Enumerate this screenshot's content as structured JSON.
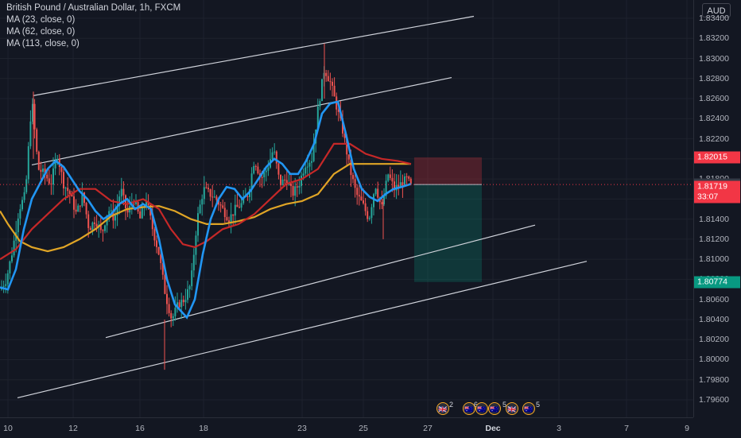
{
  "header": {
    "symbol_line": "British Pound / Australian Dollar, 1h, FXCM",
    "indicators": [
      "MA (23, close, 0)",
      "MA (62, close, 0)",
      "MA (113, close, 0)"
    ]
  },
  "price_axis": {
    "currency": "AUD",
    "ticks": [
      "1.83400",
      "1.83200",
      "1.83000",
      "1.82800",
      "1.82600",
      "1.82400",
      "1.82200",
      "1.82000",
      "1.81800",
      "1.81600",
      "1.81400",
      "1.81200",
      "1.81000",
      "1.80800",
      "1.80600",
      "1.80400",
      "1.80200",
      "1.80000",
      "1.79800",
      "1.79600"
    ],
    "labels": [
      {
        "text": "1.82015",
        "value": 1.82015,
        "color": "#f23645"
      },
      {
        "text": "1.81744",
        "value": 1.81744,
        "color": "#363a45"
      },
      {
        "text": "1.81719",
        "value": 1.81719,
        "color": "#f23645"
      },
      {
        "text": "33:07",
        "value": 1.8162,
        "color": "#f23645"
      },
      {
        "text": "1.80774",
        "value": 1.80774,
        "color": "#089981"
      }
    ]
  },
  "time_axis": {
    "ticks": [
      "10",
      "12",
      "16",
      "18",
      "23",
      "25",
      "27",
      "Dec",
      "3",
      "7",
      "9"
    ]
  },
  "events": {
    "counts": [
      "2",
      "6",
      "5",
      "5"
    ]
  },
  "chart_data": {
    "type": "candlestick",
    "symbol": "British Pound / Australian Dollar",
    "interval": "1h",
    "source": "FXCM",
    "ylim": [
      1.7948,
      1.8354
    ],
    "current_price": 1.81719,
    "position": {
      "side": "short",
      "entry": 1.81744,
      "stop": 1.82015,
      "target": 1.80774
    },
    "ma_colors": {
      "ma23": "#2196f3",
      "ma62": "#c62828",
      "ma113": "#e0a526"
    },
    "candle_colors": {
      "up": "#26a69a",
      "down": "#ef5350"
    },
    "ma23": [
      [
        0,
        1.8072
      ],
      [
        10,
        1.807
      ],
      [
        20,
        1.809
      ],
      [
        30,
        1.813
      ],
      [
        40,
        1.816
      ],
      [
        50,
        1.8175
      ],
      [
        60,
        1.819
      ],
      [
        70,
        1.8198
      ],
      [
        80,
        1.8192
      ],
      [
        90,
        1.818
      ],
      [
        100,
        1.8168
      ],
      [
        110,
        1.816
      ],
      [
        120,
        1.8148
      ],
      [
        130,
        1.814
      ],
      [
        140,
        1.8145
      ],
      [
        150,
        1.8155
      ],
      [
        160,
        1.816
      ],
      [
        170,
        1.815
      ],
      [
        180,
        1.8155
      ],
      [
        190,
        1.815
      ],
      [
        200,
        1.812
      ],
      [
        210,
        1.808
      ],
      [
        220,
        1.8055
      ],
      [
        235,
        1.8042
      ],
      [
        245,
        1.806
      ],
      [
        255,
        1.8105
      ],
      [
        265,
        1.814
      ],
      [
        275,
        1.816
      ],
      [
        285,
        1.8172
      ],
      [
        295,
        1.817
      ],
      [
        305,
        1.816
      ],
      [
        315,
        1.8168
      ],
      [
        325,
        1.818
      ],
      [
        335,
        1.8192
      ],
      [
        345,
        1.82
      ],
      [
        355,
        1.8195
      ],
      [
        365,
        1.8185
      ],
      [
        375,
        1.8185
      ],
      [
        385,
        1.8198
      ],
      [
        395,
        1.8215
      ],
      [
        405,
        1.8245
      ],
      [
        415,
        1.8255
      ],
      [
        425,
        1.8257
      ],
      [
        435,
        1.8225
      ],
      [
        445,
        1.819
      ],
      [
        455,
        1.817
      ],
      [
        465,
        1.8162
      ],
      [
        475,
        1.8158
      ],
      [
        485,
        1.8165
      ],
      [
        495,
        1.817
      ],
      [
        505,
        1.8172
      ],
      [
        517,
        1.8175
      ]
    ],
    "ma62": [
      [
        0,
        1.81
      ],
      [
        20,
        1.811
      ],
      [
        40,
        1.813
      ],
      [
        60,
        1.8145
      ],
      [
        80,
        1.816
      ],
      [
        100,
        1.817
      ],
      [
        120,
        1.817
      ],
      [
        140,
        1.8158
      ],
      [
        160,
        1.8155
      ],
      [
        180,
        1.816
      ],
      [
        200,
        1.815
      ],
      [
        215,
        1.813
      ],
      [
        230,
        1.8115
      ],
      [
        245,
        1.8112
      ],
      [
        260,
        1.8118
      ],
      [
        280,
        1.813
      ],
      [
        300,
        1.8135
      ],
      [
        320,
        1.8145
      ],
      [
        340,
        1.816
      ],
      [
        360,
        1.8175
      ],
      [
        380,
        1.818
      ],
      [
        400,
        1.819
      ],
      [
        420,
        1.8215
      ],
      [
        440,
        1.8215
      ],
      [
        460,
        1.8205
      ],
      [
        480,
        1.82
      ],
      [
        500,
        1.8198
      ],
      [
        517,
        1.8195
      ]
    ],
    "ma113": [
      [
        0,
        1.8148
      ],
      [
        10,
        1.8135
      ],
      [
        25,
        1.8118
      ],
      [
        40,
        1.8112
      ],
      [
        60,
        1.8108
      ],
      [
        80,
        1.8112
      ],
      [
        100,
        1.812
      ],
      [
        120,
        1.813
      ],
      [
        140,
        1.8143
      ],
      [
        160,
        1.815
      ],
      [
        180,
        1.8152
      ],
      [
        200,
        1.8153
      ],
      [
        220,
        1.8148
      ],
      [
        240,
        1.814
      ],
      [
        260,
        1.8135
      ],
      [
        280,
        1.8135
      ],
      [
        300,
        1.8138
      ],
      [
        320,
        1.8142
      ],
      [
        340,
        1.815
      ],
      [
        360,
        1.8155
      ],
      [
        380,
        1.8158
      ],
      [
        400,
        1.8165
      ],
      [
        420,
        1.8185
      ],
      [
        440,
        1.8195
      ],
      [
        460,
        1.8195
      ],
      [
        480,
        1.8195
      ],
      [
        500,
        1.8195
      ],
      [
        517,
        1.8195
      ]
    ],
    "close_path": [
      [
        0,
        1.807
      ],
      [
        8,
        1.808
      ],
      [
        16,
        1.811
      ],
      [
        24,
        1.815
      ],
      [
        32,
        1.8165
      ],
      [
        40,
        1.826
      ],
      [
        48,
        1.819
      ],
      [
        56,
        1.8185
      ],
      [
        64,
        1.8175
      ],
      [
        72,
        1.8205
      ],
      [
        80,
        1.8175
      ],
      [
        88,
        1.8165
      ],
      [
        96,
        1.8145
      ],
      [
        104,
        1.8165
      ],
      [
        112,
        1.813
      ],
      [
        120,
        1.814
      ],
      [
        128,
        1.8125
      ],
      [
        136,
        1.815
      ],
      [
        144,
        1.814
      ],
      [
        152,
        1.817
      ],
      [
        160,
        1.8145
      ],
      [
        168,
        1.816
      ],
      [
        176,
        1.814
      ],
      [
        184,
        1.816
      ],
      [
        192,
        1.813
      ],
      [
        200,
        1.8105
      ],
      [
        208,
        1.8065
      ],
      [
        216,
        1.804
      ],
      [
        224,
        1.8055
      ],
      [
        232,
        1.806
      ],
      [
        240,
        1.8075
      ],
      [
        248,
        1.814
      ],
      [
        256,
        1.817
      ],
      [
        264,
        1.8165
      ],
      [
        272,
        1.816
      ],
      [
        280,
        1.815
      ],
      [
        288,
        1.814
      ],
      [
        296,
        1.815
      ],
      [
        304,
        1.8155
      ],
      [
        312,
        1.8165
      ],
      [
        320,
        1.82
      ],
      [
        328,
        1.818
      ],
      [
        336,
        1.819
      ],
      [
        344,
        1.821
      ],
      [
        352,
        1.8175
      ],
      [
        360,
        1.818
      ],
      [
        368,
        1.8165
      ],
      [
        376,
        1.8175
      ],
      [
        384,
        1.8195
      ],
      [
        392,
        1.82
      ],
      [
        400,
        1.825
      ],
      [
        408,
        1.829
      ],
      [
        416,
        1.8275
      ],
      [
        424,
        1.825
      ],
      [
        432,
        1.8225
      ],
      [
        440,
        1.819
      ],
      [
        448,
        1.8165
      ],
      [
        456,
        1.8155
      ],
      [
        464,
        1.814
      ],
      [
        472,
        1.8175
      ],
      [
        480,
        1.815
      ],
      [
        488,
        1.8185
      ],
      [
        496,
        1.817
      ],
      [
        504,
        1.8175
      ],
      [
        512,
        1.818
      ],
      [
        517,
        1.8172
      ]
    ],
    "trend_lines": [
      [
        [
          42,
          1.8263
        ],
        [
          596,
          1.8342
        ]
      ],
      [
        [
          40,
          1.8194
        ],
        [
          568,
          1.8281
        ]
      ],
      [
        [
          133,
          1.8022
        ],
        [
          673,
          1.8134
        ]
      ],
      [
        [
          22,
          1.7962
        ],
        [
          738,
          1.8098
        ]
      ]
    ]
  }
}
